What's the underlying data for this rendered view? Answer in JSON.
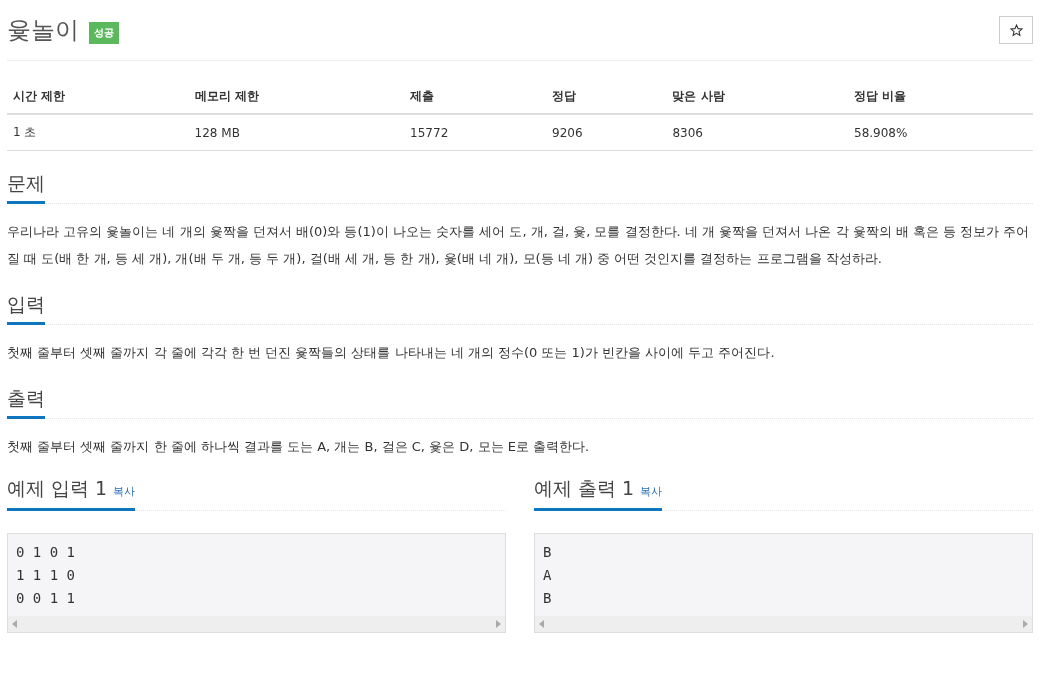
{
  "title": "윷놀이",
  "badge": "성공",
  "stats": {
    "columns": [
      "시간 제한",
      "메모리 제한",
      "제출",
      "정답",
      "맞은 사람",
      "정답 비율"
    ],
    "row": [
      "1 초",
      "128 MB",
      "15772",
      "9206",
      "8306",
      "58.908%"
    ]
  },
  "sections": [
    {
      "heading": "문제",
      "text": "우리나라 고유의 윷놀이는 네 개의 윷짝을 던져서 배(0)와 등(1)이 나오는 숫자를 세어 도, 개, 걸, 윷, 모를 결정한다. 네 개 윷짝을 던져서 나온 각 윷짝의 배 혹은 등 정보가 주어질 때 도(배 한 개, 등 세 개), 개(배 두 개, 등 두 개), 걸(배 세 개, 등 한 개), 윷(배 네 개), 모(등 네 개) 중 어떤 것인지를 결정하는 프로그램을 작성하라."
    },
    {
      "heading": "입력",
      "text": "첫째 줄부터 셋째 줄까지 각 줄에 각각 한 번 던진 윷짝들의 상태를 나타내는 네 개의 정수(0 또는 1)가  빈칸을 사이에 두고 주어진다."
    },
    {
      "heading": "출력",
      "text": "첫째 줄부터 셋째 줄까지 한 줄에 하나씩 결과를  도는 A, 개는 B, 걸은 C, 윷은 D, 모는 E로 출력한다."
    }
  ],
  "samples": [
    {
      "heading": "예제 입력 1",
      "copy": "복사",
      "lines": [
        "0 1 0 1",
        "1 1 1 0",
        "0 0 1 1"
      ]
    },
    {
      "heading": "예제 출력 1",
      "copy": "복사",
      "lines": [
        "B",
        "A",
        "B"
      ]
    }
  ]
}
